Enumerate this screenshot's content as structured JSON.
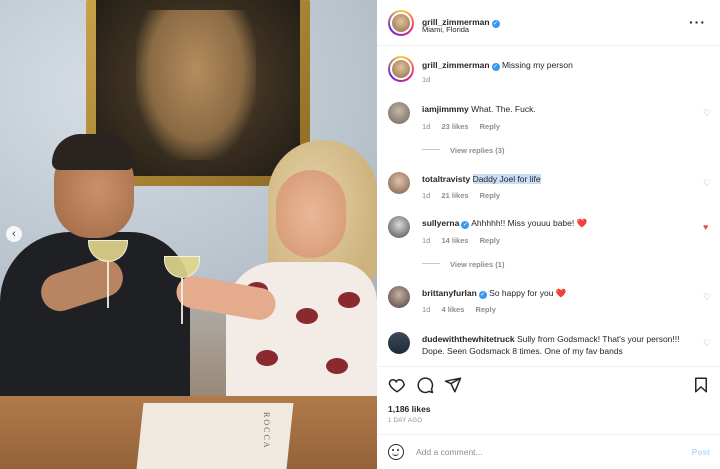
{
  "post": {
    "author": "grill_zimmerman",
    "location": "Miami, Florida",
    "caption": "Missing my person",
    "caption_age": "1d",
    "likes": "1,186 likes",
    "ago": "1 DAY AGO"
  },
  "photo": {
    "menu_text": "ROCCA"
  },
  "comments": [
    {
      "user": "iamjimmmy",
      "verified": false,
      "text": "What. The. Fuck.",
      "age": "1d",
      "likes": "23 likes",
      "reply": "Reply",
      "view_replies": "View replies (3)",
      "liked": false
    },
    {
      "user": "totaltravisty",
      "verified": false,
      "text": "Daddy Joel for life",
      "age": "1d",
      "likes": "21 likes",
      "reply": "Reply",
      "view_replies": "",
      "liked": false
    },
    {
      "user": "sullyerna",
      "verified": true,
      "text": "Ahhhhh!! Miss youuu babe! ❤️",
      "age": "1d",
      "likes": "14 likes",
      "reply": "Reply",
      "view_replies": "View replies (1)",
      "liked": true
    },
    {
      "user": "brittanyfurlan",
      "verified": true,
      "text": "So happy for you ❤️",
      "age": "1d",
      "likes": "4 likes",
      "reply": "Reply",
      "view_replies": "",
      "liked": false
    },
    {
      "user": "dudewiththewhitetruck",
      "verified": false,
      "text": "Sully from Godsmack! That's your person!!! Dope. Seen Godsmack 8 times. One of my fav bands",
      "age": "",
      "likes": "",
      "reply": "",
      "view_replies": "",
      "liked": false
    }
  ],
  "input": {
    "placeholder": "Add a comment...",
    "post_label": "Post"
  },
  "icons": {
    "more": "more-options-icon",
    "like": "heart-icon",
    "comment": "comment-icon",
    "share": "share-icon",
    "save": "bookmark-icon",
    "emoji": "emoji-icon",
    "carousel_prev": "chevron-left-icon"
  },
  "colors": {
    "verified": "#3897f0",
    "liked_heart": "#ed4956",
    "muted": "#8e8e8e",
    "highlight": "#c9dcf8",
    "post_button": "#b3dbff"
  }
}
